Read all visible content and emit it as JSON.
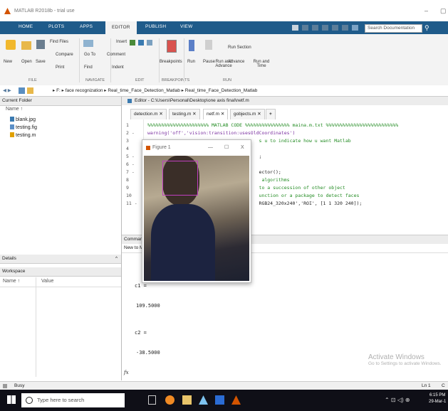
{
  "window": {
    "title": "MATLAB R2018b - trial use"
  },
  "ribbon": {
    "tabs": [
      "HOME",
      "PLOTS",
      "APPS",
      "EDITOR",
      "PUBLISH",
      "VIEW"
    ],
    "active_tab": "EDITOR",
    "search_placeholder": "Search Documentation",
    "file": {
      "new": "New",
      "open": "Open",
      "save": "Save",
      "find_files": "Find Files",
      "compare": "Compare",
      "print": "Print",
      "label": "FILE"
    },
    "navigate": {
      "goto": "Go To",
      "find": "Find",
      "label": "NAVIGATE"
    },
    "edit": {
      "insert": "Insert",
      "comment": "Comment",
      "indent": "Indent",
      "label": "EDIT"
    },
    "breakpoints": {
      "breakpoints": "Breakpoints",
      "label": "BREAKPOINTS"
    },
    "run": {
      "run": "Run",
      "pause": "Pause",
      "run_and_advance": "Run and Advance",
      "run_section": "Run Section",
      "advance": "Advance",
      "run_and_time": "Run and Time",
      "label": "RUN"
    }
  },
  "address": {
    "crumbs": [
      "F:",
      "face recognization",
      "Real_time_Face_Detection_Matlab",
      "Real_time_Face_Detection_Matlab"
    ]
  },
  "current_folder": {
    "title": "Current Folder",
    "col_name": "Name ↑",
    "files": [
      "blank.jpg",
      "testing.fig",
      "testing.m"
    ]
  },
  "details": {
    "title": "Details",
    "chevron": "^"
  },
  "workspace": {
    "title": "Workspace",
    "col_name": "Name ↑",
    "col_value": "Value"
  },
  "editor": {
    "header": "Editor - C:\\Users\\Personal\\Desktop\\one axis final\\netf.m",
    "tabs": [
      "detection.m",
      "testing.m",
      "netf.m",
      "gobjects.m"
    ],
    "active_tab": "netf.m",
    "lines": [
      {
        "n": "1",
        "text": "%%%%%%%%%%%%%%%%%%%%%% MATLAB CODE %%%%%%%%%%%%%%%% maina.m.txt %%%%%%%%%%%%%%%%%%%%%%%%%%"
      },
      {
        "n": "2 -",
        "text": "warning('off','vision:transition:usesOldCoordinates')"
      },
      {
        "n": "3",
        "text": "                                        s u to indicate how u want Matlab"
      },
      {
        "n": "4",
        "text": ""
      },
      {
        "n": "5 -",
        "text": "                                        ;"
      },
      {
        "n": "6 -",
        "text": ""
      },
      {
        "n": "7 -",
        "text": "                                        ector();"
      },
      {
        "n": "8",
        "text": "                                         algorithms"
      },
      {
        "n": "9",
        "text": "                                        to a succession of other object"
      },
      {
        "n": "10",
        "text": "                                        unction or a package to detect faces"
      },
      {
        "n": "11 -",
        "text": "                                        RGB24_320x240','ROI', [1 1 320 240]);"
      }
    ]
  },
  "command_window": {
    "title": "Command Window",
    "new_to": "New to MATLAB? See resources for Getting Started.",
    "output": [
      "c1 =",
      "109.5000",
      "c2 =",
      "-38.5000"
    ],
    "prompt": "fx"
  },
  "figure": {
    "title": "Figure 1",
    "min": "—",
    "max": "☐",
    "close": "X"
  },
  "status": {
    "text": "Busy",
    "ln": "Ln 1",
    "col": "C"
  },
  "watermark": {
    "line1": "Activate Windows",
    "line2": "Go to Settings to activate Windows."
  },
  "taskbar": {
    "search_placeholder": "Type here to search",
    "time": "6:15 PM",
    "date": "29-Mar-1"
  },
  "colors": {
    "ribbon_blue": "#1f5b8a",
    "face_box": "#c040c0",
    "taskbar": "#0f0f17"
  }
}
